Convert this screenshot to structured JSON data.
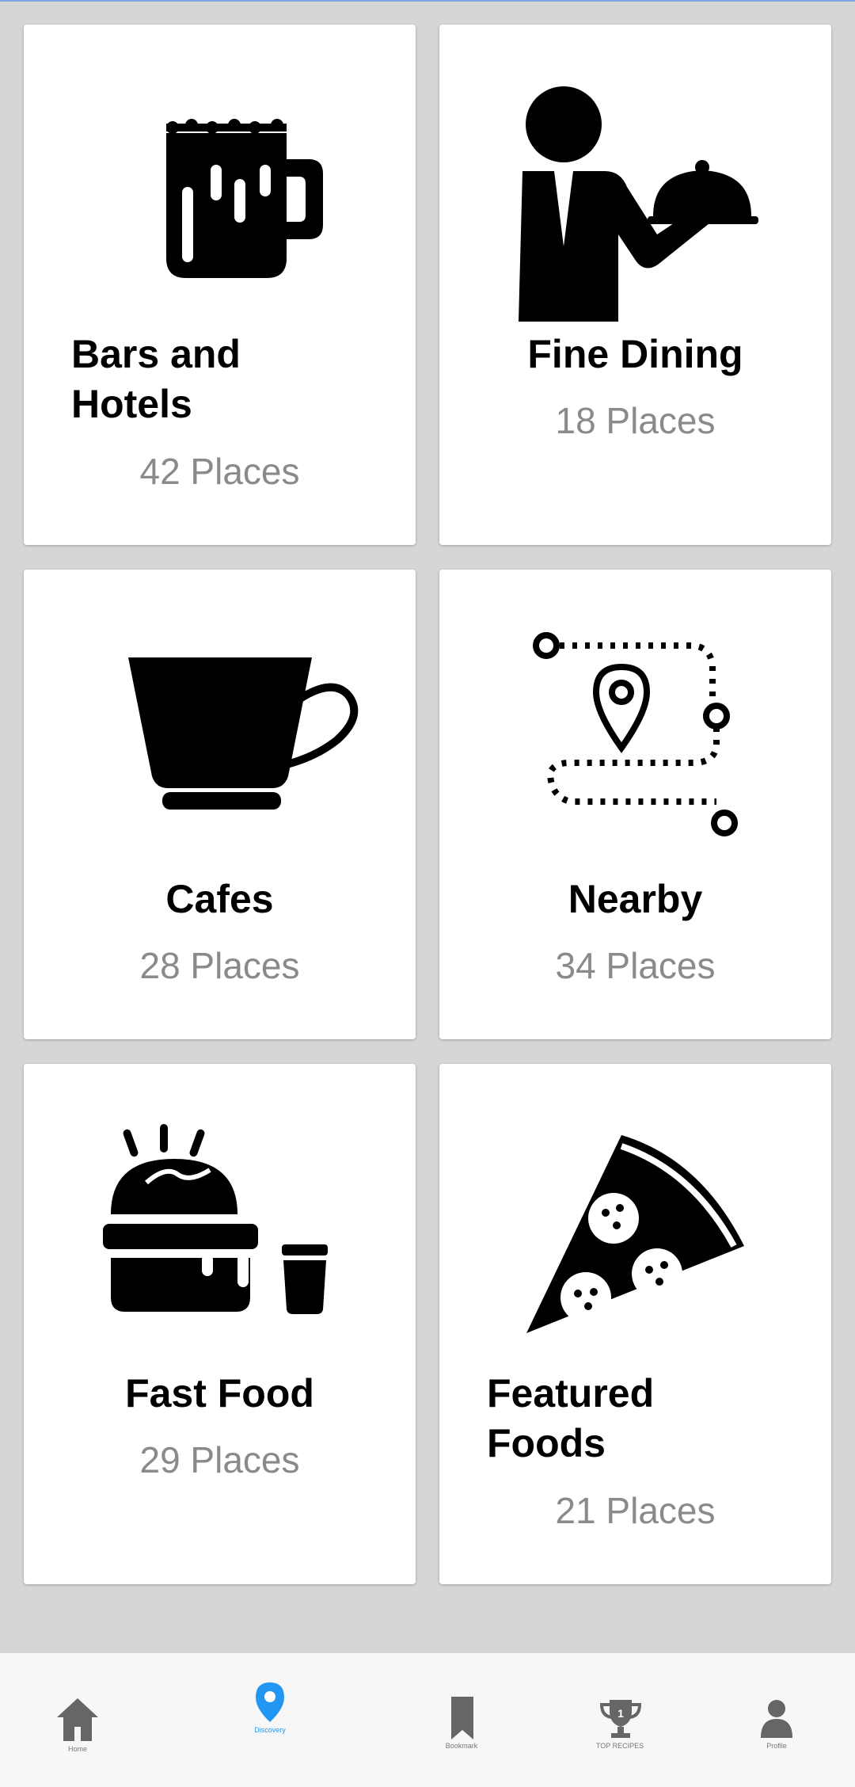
{
  "categories": [
    {
      "title": "Bars and Hotels",
      "count": "42 Places",
      "icon": "beer-mug-icon"
    },
    {
      "title": "Fine Dining",
      "count": "18 Places",
      "icon": "waiter-cloche-icon"
    },
    {
      "title": "Cafes",
      "count": "28 Places",
      "icon": "coffee-cup-icon"
    },
    {
      "title": "Nearby",
      "count": "34 Places",
      "icon": "route-pin-icon"
    },
    {
      "title": "Fast Food",
      "count": "29 Places",
      "icon": "burger-drink-icon"
    },
    {
      "title": "Featured Foods",
      "count": "21 Places",
      "icon": "pizza-slice-icon"
    }
  ],
  "nav": {
    "items": [
      {
        "label": "Home",
        "icon": "home-icon"
      },
      {
        "label": "Discovery",
        "icon": "map-pin-icon",
        "active": true
      },
      {
        "label": "Bookmark",
        "icon": "bookmark-icon"
      },
      {
        "label": "TOP RECIPES",
        "icon": "trophy-icon"
      },
      {
        "label": "Profile",
        "icon": "profile-icon"
      }
    ],
    "accent": "#2196f3",
    "inactive_color": "#666666"
  }
}
